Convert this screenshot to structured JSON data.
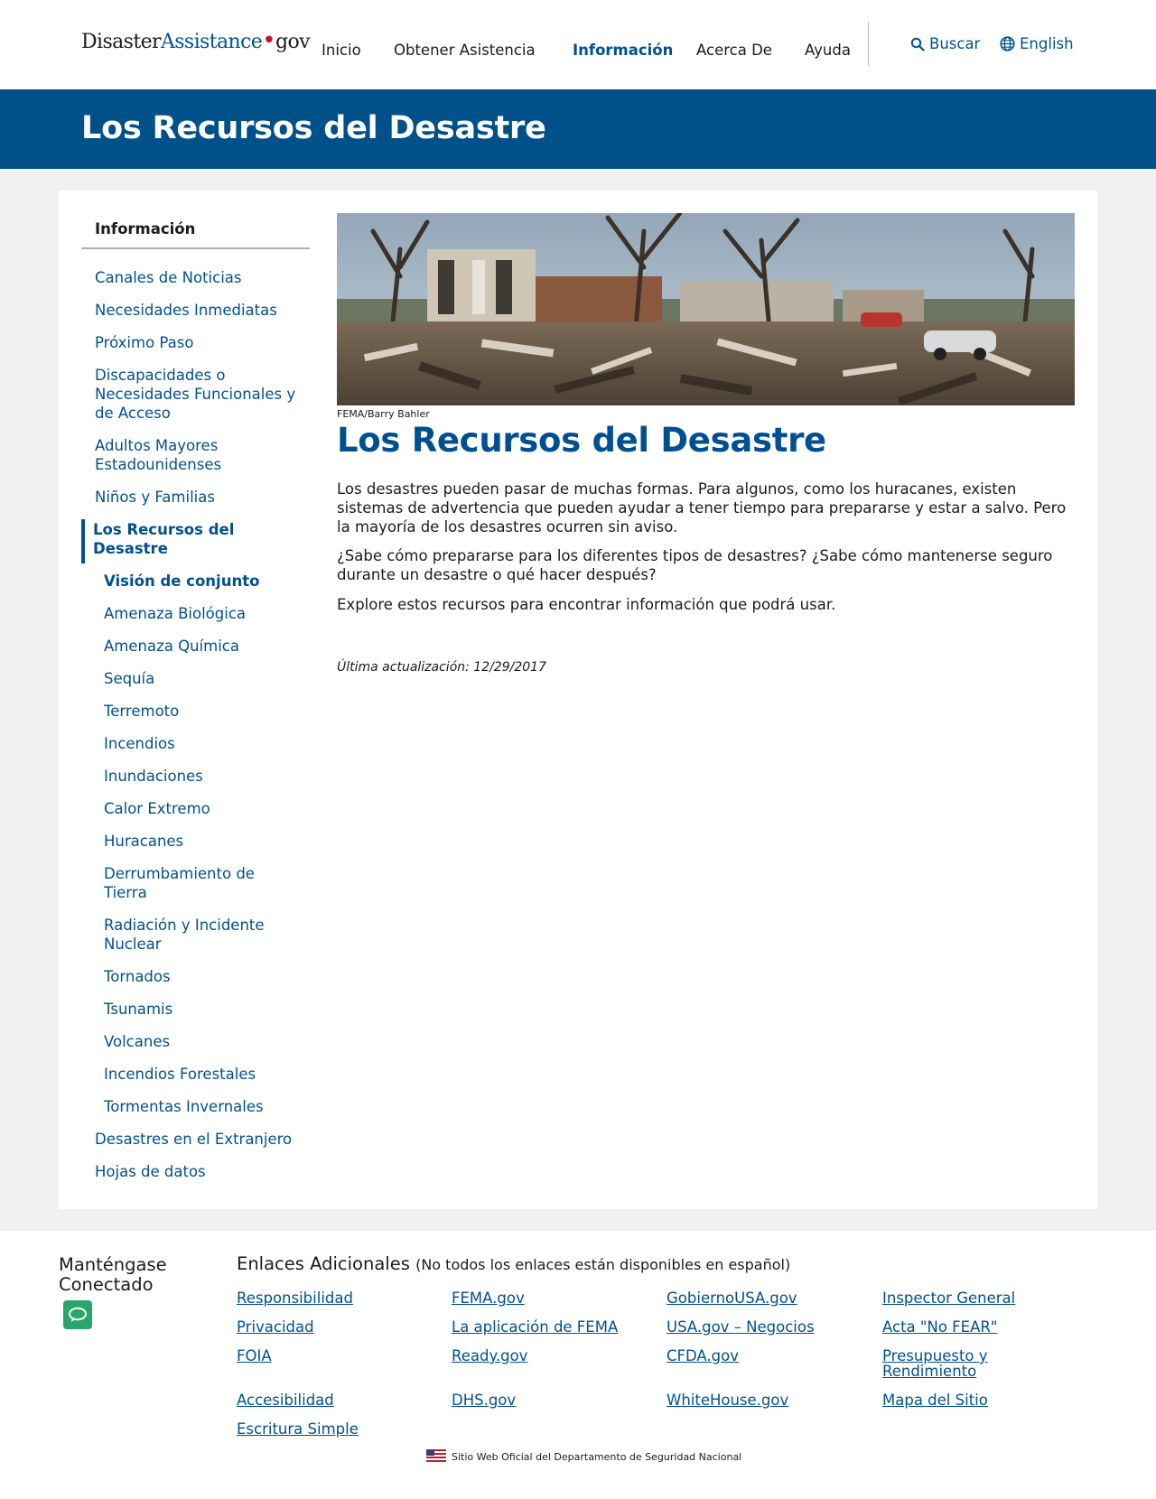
{
  "header": {
    "logo": {
      "part1": "Disaster",
      "part2": "Assistance",
      "dot": "•",
      "part3": "gov"
    },
    "nav": [
      "Inicio",
      "Obtener Asistencia",
      "Información",
      "Acerca De",
      "Ayuda"
    ],
    "search_label": "Buscar",
    "language_label": "English",
    "icons": {
      "search": "search-icon",
      "language": "globe-icon"
    }
  },
  "hero": {
    "title": "Los Recursos del Desastre"
  },
  "sidebar": {
    "title": "Información",
    "items": [
      "Canales de Noticias",
      "Necesidades Inmediatas",
      "Próximo Paso",
      "Discapacidades o",
      "Necesidades Funcionales y",
      "de Acceso",
      "Adultos Mayores",
      "Estadounidenses",
      "Niños y Familias",
      "Los Recursos del",
      "Desastre",
      "Visión de conjunto",
      "Amenaza Biológica",
      "Amenaza Química",
      "Sequía",
      "Terremoto",
      "Incendios",
      "Inundaciones",
      "Calor Extremo",
      "Huracanes",
      "Derrumbamiento de",
      "Tierra",
      "Radiación y Incidente",
      "Nuclear",
      "Tornados",
      "Tsunamis",
      "Volcanes",
      "Incendios Forestales",
      "Tormentas Invernales",
      "Desastres en el Extranjero",
      "Hojas de datos"
    ]
  },
  "content": {
    "photo_credit": "FEMA/Barry Bahler",
    "title": "Los Recursos del Desastre",
    "paragraphs": [
      "Los desastres pueden pasar de muchas formas. Para algunos, como los huracanes, existen sistemas de advertencia que pueden ayudar a tener tiempo para prepararse y estar a salvo. Pero la mayoría de los desastres ocurren sin aviso.",
      "¿Sabe cómo prepararse para los diferentes tipos de desastres? ¿Sabe cómo mantenerse seguro durante un desastre o qué hacer después?",
      "Explore estos recursos para encontrar información que podrá usar."
    ],
    "last_updated": "Última actualización: 12/29/2017"
  },
  "footer": {
    "stay_connected": [
      "Manténgase",
      "Conectado"
    ],
    "links_title": "Enlaces Adicionales",
    "links_note": "(No todos los enlaces están disponibles en español)",
    "links": [
      "Responsibilidad",
      "FEMA.gov",
      "GobiernoUSA.gov",
      "Inspector General",
      "Privacidad",
      "La aplicación de FEMA",
      "USA.gov – Negocios",
      "Acta \"No FEAR\"",
      "FOIA",
      "Ready.gov",
      "CFDA.gov",
      "Presupuesto y",
      "Rendimiento",
      "Accesibilidad",
      "DHS.gov",
      "WhiteHouse.gov",
      "Mapa del Sitio",
      "Escritura Simple"
    ],
    "official_site": "Sitio Web Oficial del Departamento de Seguridad Nacional",
    "icons": {
      "chat": "chat-bubble-icon",
      "flag": "us-flag-icon"
    }
  },
  "colors": {
    "brand_blue": "#005091",
    "hero_blue": "#005089",
    "chat_green": "#2aa66a",
    "logo_red": "#d0102e"
  }
}
